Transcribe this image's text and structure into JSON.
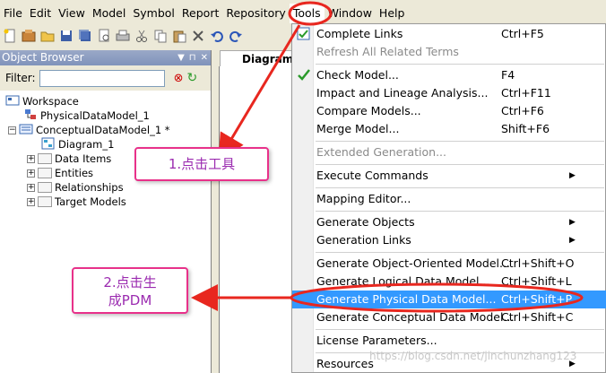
{
  "menubar": {
    "items": [
      "File",
      "Edit",
      "View",
      "Model",
      "Symbol",
      "Report",
      "Repository",
      "Tools",
      "Window",
      "Help"
    ],
    "active": "Tools"
  },
  "browser": {
    "title": "Object Browser",
    "filter_label": "Filter:",
    "filter_value": "",
    "tree": {
      "workspace": "Workspace",
      "physical_model": "PhysicalDataModel_1",
      "conceptual_model": "ConceptualDataModel_1 *",
      "diagram": "Diagram_1",
      "folders": [
        "Data Items",
        "Entities",
        "Relationships",
        "Target Models"
      ]
    }
  },
  "document_tab": "Diagram_",
  "tools_menu": [
    {
      "label": "Complete Links",
      "shortcut": "Ctrl+F5",
      "state": "normal",
      "icon": "complete-links-icon"
    },
    {
      "label": "Refresh All Related Terms",
      "shortcut": "",
      "state": "disabled"
    },
    {
      "label": "Check Model...",
      "shortcut": "F4",
      "state": "normal",
      "icon": "check-model-icon"
    },
    {
      "label": "Impact and Lineage Analysis...",
      "shortcut": "Ctrl+F11",
      "state": "normal"
    },
    {
      "label": "Compare Models...",
      "shortcut": "Ctrl+F6",
      "state": "normal"
    },
    {
      "label": "Merge Model...",
      "shortcut": "Shift+F6",
      "state": "normal"
    },
    {
      "label": "Extended Generation...",
      "shortcut": "",
      "state": "disabled"
    },
    {
      "label": "Execute Commands",
      "shortcut": "",
      "state": "submenu"
    },
    {
      "label": "Mapping Editor...",
      "shortcut": "",
      "state": "normal"
    },
    {
      "label": "Generate Objects",
      "shortcut": "",
      "state": "submenu"
    },
    {
      "label": "Generation Links",
      "shortcut": "",
      "state": "submenu"
    },
    {
      "label": "Generate Object-Oriented Model...",
      "shortcut": "Ctrl+Shift+O",
      "state": "normal"
    },
    {
      "label": "Generate Logical Data Model...",
      "shortcut": "Ctrl+Shift+L",
      "state": "normal"
    },
    {
      "label": "Generate Physical Data Model...",
      "shortcut": "Ctrl+Shift+P",
      "state": "highlight"
    },
    {
      "label": "Generate Conceptual Data Model...",
      "shortcut": "Ctrl+Shift+C",
      "state": "normal"
    },
    {
      "label": "License Parameters...",
      "shortcut": "",
      "state": "normal"
    },
    {
      "label": "Resources",
      "shortcut": "",
      "state": "submenu"
    }
  ],
  "annotations": {
    "step1": "1.点击工具",
    "step2_line1": "2.点击生",
    "step2_line2": "成PDM"
  },
  "watermark": "https://blog.csdn.net/jinchunzhang123",
  "colors": {
    "highlight": "#3399ff",
    "annotation_red": "#e8271f",
    "callout_border": "#e8318a",
    "callout_text": "#9b2bb0"
  }
}
